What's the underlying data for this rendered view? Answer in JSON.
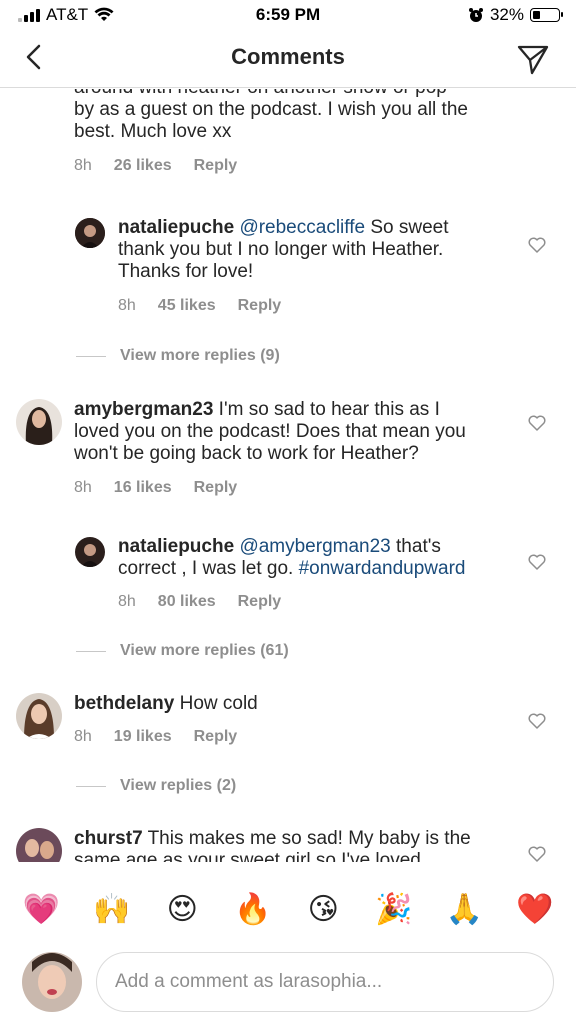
{
  "status": {
    "carrier": "AT&T",
    "time": "6:59 PM",
    "battery": "32%",
    "battery_level": 0.32
  },
  "nav": {
    "title": "Comments"
  },
  "comments": [
    {
      "text_lines": [
        "around with heather on another show or pop",
        "by as a guest on the podcast. I wish you all the",
        "best. Much love xx"
      ],
      "ago": "8h",
      "likes": "26 likes",
      "reply": "Reply"
    },
    {
      "user": "nataliepuche",
      "mention": "@rebeccacliffe",
      "text1": " So sweet",
      "text2": "thank you but I no longer with Heather.",
      "text3": "Thanks for love!",
      "ago": "8h",
      "likes": "45 likes",
      "reply": "Reply"
    },
    {
      "more": "View more replies (9)"
    },
    {
      "user": "amybergman23",
      "text1": " I'm so sad to hear this as I",
      "text2": "loved you on the podcast!  Does that mean you",
      "text3": "won't be going back to work for Heather?",
      "ago": "8h",
      "likes": "16 likes",
      "reply": "Reply"
    },
    {
      "user": "nataliepuche",
      "mention": "@amybergman23",
      "text1": " that's",
      "text2a": "correct , I was let go. ",
      "tag": "#onwardandupward",
      "ago": "8h",
      "likes": "80 likes",
      "reply": "Reply"
    },
    {
      "more": "View more replies (61)"
    },
    {
      "user": "bethdelany",
      "text1": " How cold",
      "ago": "8h",
      "likes": "19 likes",
      "reply": "Reply"
    },
    {
      "more": "View replies (2)"
    },
    {
      "user": "churst7",
      "text1": " This makes me so sad! My baby is the",
      "text2": "same age as your sweet girl so I've loved"
    }
  ],
  "emoji": [
    "💗",
    "🙌",
    "😍",
    "🔥",
    "😘",
    "🎉",
    "🙏",
    "❤️"
  ],
  "composer": {
    "placeholder": "Add a comment as larasophia..."
  }
}
